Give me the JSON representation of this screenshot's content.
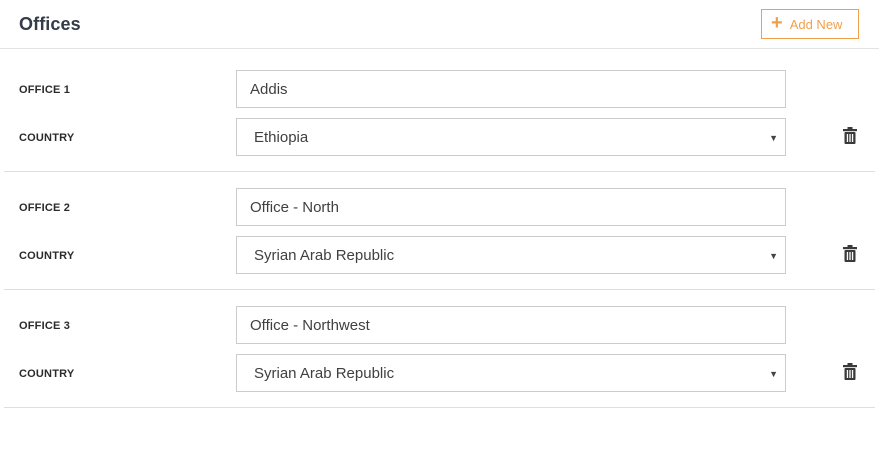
{
  "header": {
    "title": "Offices",
    "add_label": "Add New",
    "add_icon": "plus-icon",
    "accent_color": "#f0a04b"
  },
  "offices": [
    {
      "label": "OFFICE 1",
      "name": "Addis",
      "country_label": "COUNTRY",
      "country": "Ethiopia",
      "delete_icon": "trash-icon"
    },
    {
      "label": "OFFICE 2",
      "name": "Office - North",
      "country_label": "COUNTRY",
      "country": "Syrian Arab Republic",
      "delete_icon": "trash-icon"
    },
    {
      "label": "OFFICE 3",
      "name": "Office - Northwest",
      "country_label": "COUNTRY",
      "country": "Syrian Arab Republic",
      "delete_icon": "trash-icon"
    }
  ]
}
